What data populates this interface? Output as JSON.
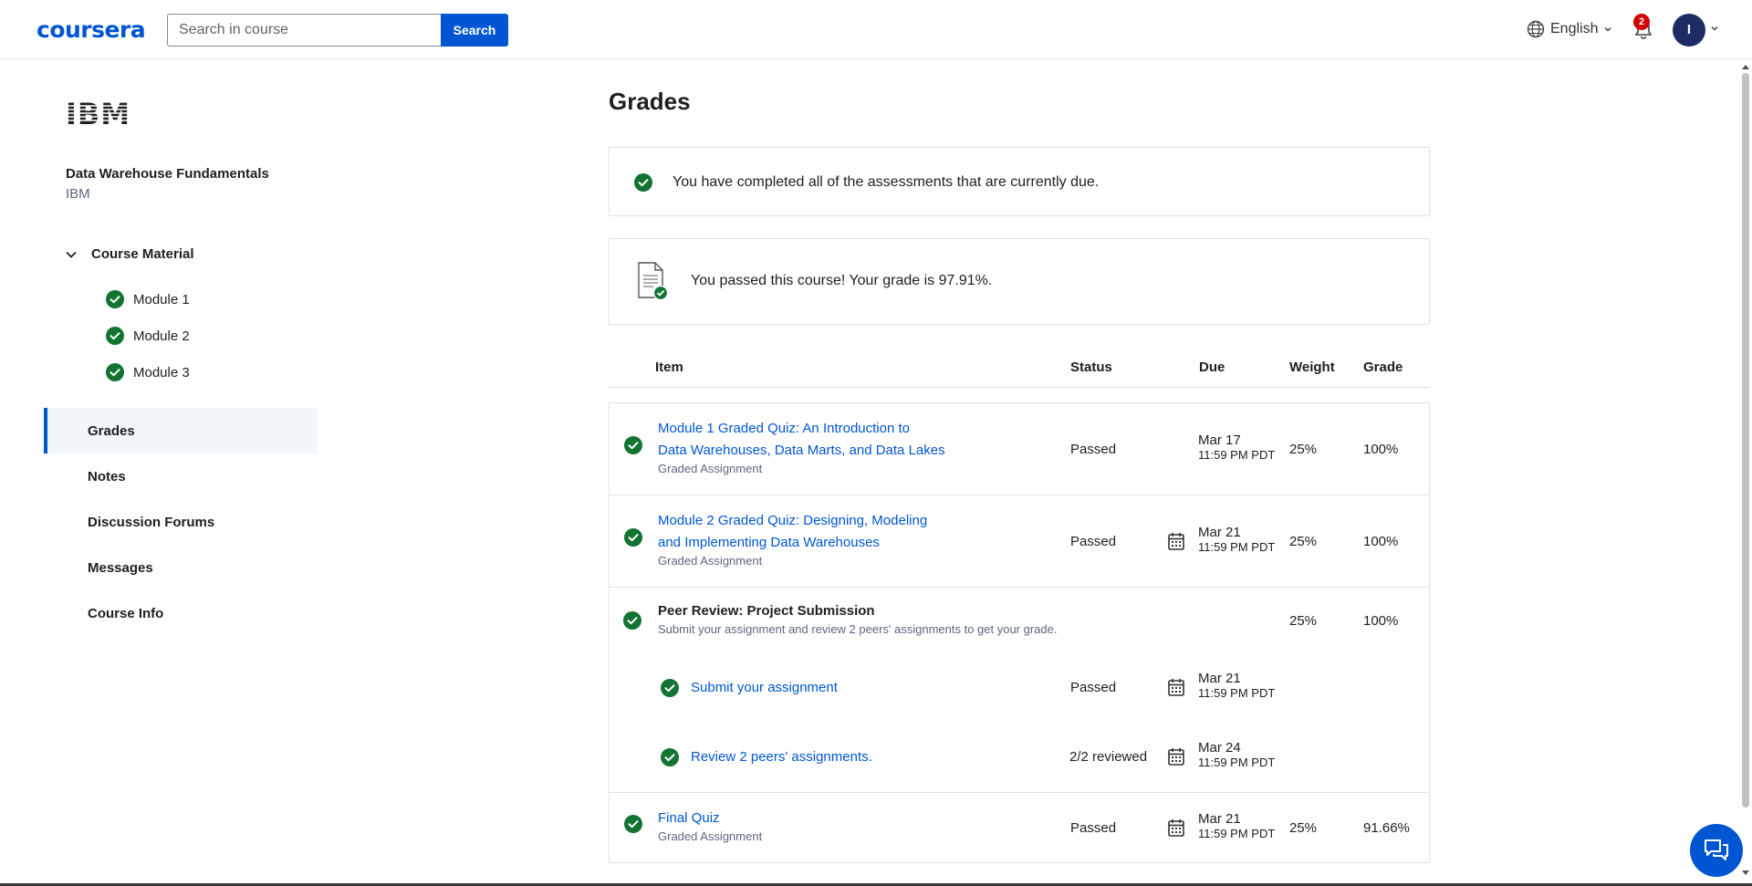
{
  "header": {
    "logo_text": "coursera",
    "search_placeholder": "Search in course",
    "search_button": "Search",
    "language": "English",
    "notification_count": "2",
    "avatar_initial": "I"
  },
  "sidebar": {
    "partner_logo": "IBM",
    "course_title": "Data Warehouse Fundamentals",
    "course_org": "IBM",
    "course_material_label": "Course Material",
    "modules": [
      "Module 1",
      "Module 2",
      "Module 3"
    ],
    "nav": [
      "Grades",
      "Notes",
      "Discussion Forums",
      "Messages",
      "Course Info"
    ],
    "active_nav": "Grades"
  },
  "main": {
    "title": "Grades",
    "completed_message": "You have completed all of the assessments that are currently due.",
    "passed_message": "You passed this course! Your grade is 97.91%.",
    "columns": {
      "item": "Item",
      "status": "Status",
      "due": "Due",
      "weight": "Weight",
      "grade": "Grade"
    },
    "rows": [
      {
        "title_line1": "Module 1 Graded Quiz: An Introduction to",
        "title_line2": "Data Warehouses, Data Marts, and Data Lakes",
        "type": "Graded Assignment",
        "status": "Passed",
        "due_date": "Mar 17",
        "due_time": "11:59 PM PDT",
        "weight": "25%",
        "grade": "100%"
      },
      {
        "title_line1": "Module 2 Graded Quiz: Designing, Modeling",
        "title_line2": "and Implementing Data Warehouses",
        "type": "Graded Assignment",
        "status": "Passed",
        "due_date": "Mar 21",
        "due_time": "11:59 PM PDT",
        "weight": "25%",
        "grade": "100%"
      },
      {
        "title": "Peer Review: Project Submission",
        "subtitle": "Submit your assignment and review 2 peers' assignments to get your grade.",
        "weight": "25%",
        "grade": "100%",
        "subitems": [
          {
            "title": "Submit your assignment",
            "status": "Passed",
            "due_date": "Mar 21",
            "due_time": "11:59 PM PDT"
          },
          {
            "title": "Review 2 peers' assignments.",
            "status": "2/2 reviewed",
            "due_date": "Mar 24",
            "due_time": "11:59 PM PDT"
          }
        ]
      },
      {
        "title": "Final Quiz",
        "type": "Graded Assignment",
        "status": "Passed",
        "due_date": "Mar 21",
        "due_time": "11:59 PM PDT",
        "weight": "25%",
        "grade": "91.66%"
      }
    ]
  },
  "colors": {
    "brand": "#0056d2",
    "success": "#137333",
    "badge": "#d30001"
  }
}
